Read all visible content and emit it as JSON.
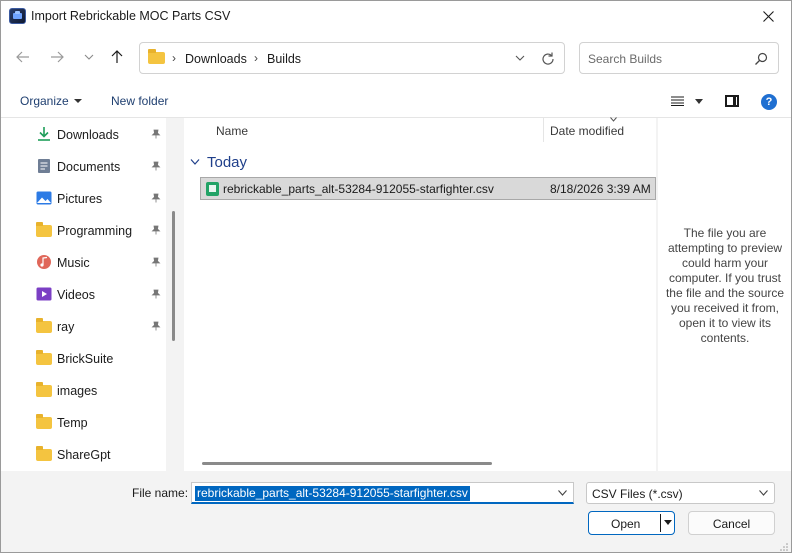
{
  "window": {
    "title": "Import Rebrickable MOC Parts CSV"
  },
  "address": {
    "breadcrumbs": [
      "Downloads",
      "Builds"
    ],
    "search_placeholder": "Search Builds"
  },
  "toolbar": {
    "organize_label": "Organize",
    "new_folder_label": "New folder",
    "help_glyph": "?"
  },
  "nav": {
    "items": [
      {
        "label": "Downloads",
        "icon": "download-icon",
        "pinned": true
      },
      {
        "label": "Documents",
        "icon": "documents-icon",
        "pinned": true
      },
      {
        "label": "Pictures",
        "icon": "pictures-icon",
        "pinned": true
      },
      {
        "label": "Programming",
        "icon": "folder-icon",
        "pinned": true
      },
      {
        "label": "Music",
        "icon": "music-icon",
        "pinned": true
      },
      {
        "label": "Videos",
        "icon": "videos-icon",
        "pinned": true
      },
      {
        "label": "ray",
        "icon": "folder-icon",
        "pinned": true
      },
      {
        "label": "BrickSuite",
        "icon": "folder-icon",
        "pinned": false
      },
      {
        "label": "images",
        "icon": "folder-icon",
        "pinned": false
      },
      {
        "label": "Temp",
        "icon": "folder-icon",
        "pinned": false
      },
      {
        "label": "ShareGpt",
        "icon": "folder-icon",
        "pinned": false
      }
    ]
  },
  "filelist": {
    "columns": {
      "name": "Name",
      "date": "Date modified"
    },
    "group": "Today",
    "files": [
      {
        "name": "rebrickable_parts_alt-53284-912055-starfighter.csv",
        "date": "8/18/2026 3:39 AM"
      }
    ]
  },
  "preview": {
    "message": "The file you are attempting to preview could harm your computer. If you trust the file and the source you received it from, open it to view its contents."
  },
  "bottom": {
    "filename_label": "File name:",
    "filename_value": "rebrickable_parts_alt-53284-912055-starfighter.csv",
    "filter_value": "CSV Files (*.csv)",
    "open_label": "Open",
    "cancel_label": "Cancel"
  },
  "colors": {
    "accent": "#0067c0",
    "folder": "#f4c440",
    "csv": "#21a366"
  }
}
